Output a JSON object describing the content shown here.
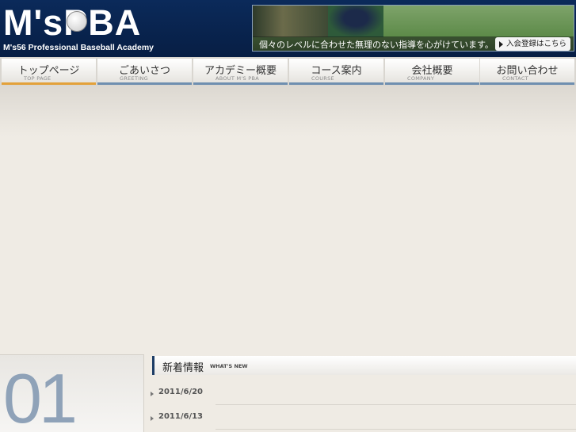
{
  "header": {
    "logo_text": "M'sPBA",
    "logo_subtitle": "M's56 Professional Baseball Academy",
    "banner": {
      "caption": "個々のレベルに合わせた無理のない指導を心がけています。",
      "join_label": "入会登録はこちら"
    }
  },
  "nav": {
    "items": [
      {
        "label": "トップページ",
        "sub": "TOP PAGE"
      },
      {
        "label": "ごあいさつ",
        "sub": "GREETING"
      },
      {
        "label": "アカデミー概要",
        "sub": "ABOUT M'S PBA"
      },
      {
        "label": "コース案内",
        "sub": "COURSE"
      },
      {
        "label": "会社概要",
        "sub": "COMPANY"
      },
      {
        "label": "お問い合わせ",
        "sub": "CONTACT"
      }
    ]
  },
  "section": {
    "number": "01"
  },
  "news": {
    "title": "新着情報",
    "subtitle": "WHAT'S NEW",
    "items": [
      {
        "date": "2011/6/20"
      },
      {
        "date": "2011/6/13"
      }
    ]
  },
  "colors": {
    "header_bg": "#0b2a5a",
    "nav_underline": "#6f8fb0",
    "nav_active_underline": "#e3a13a",
    "number_color": "#8fa2b8",
    "page_bg": "#efebe4"
  }
}
